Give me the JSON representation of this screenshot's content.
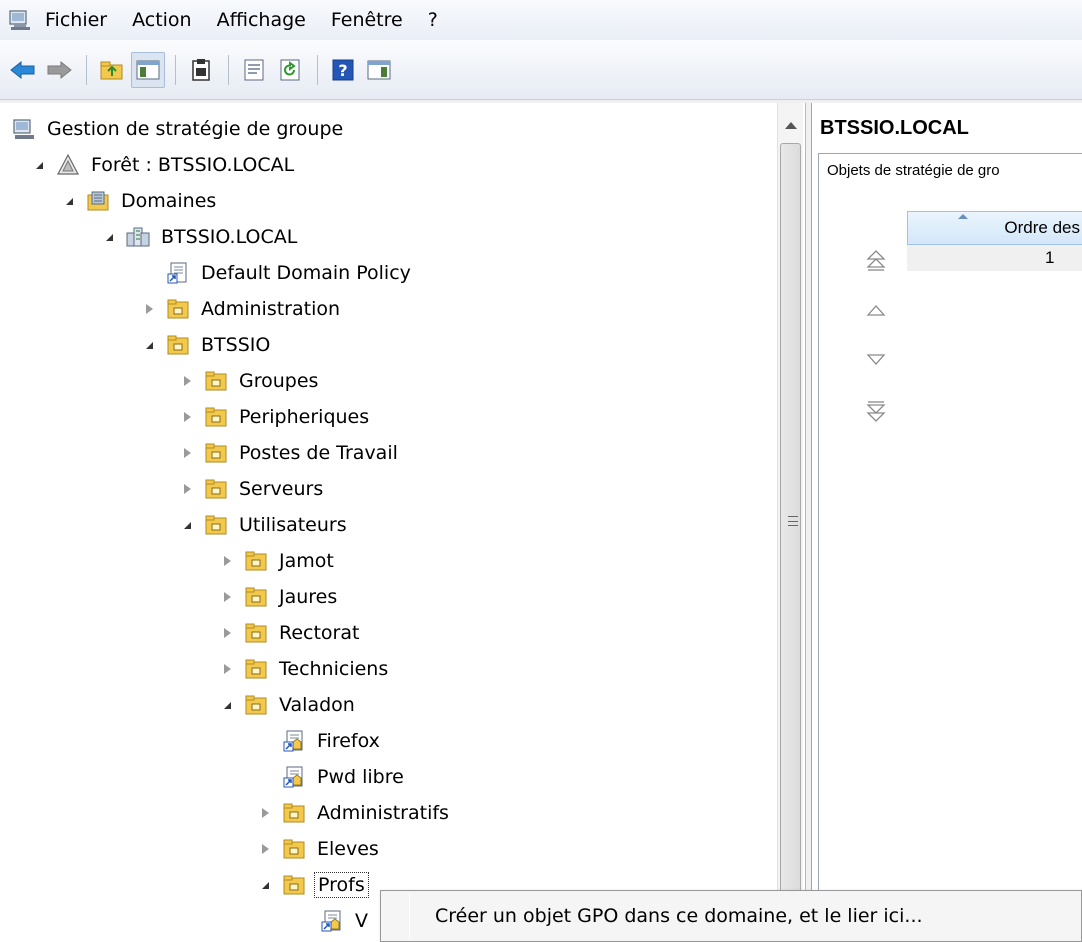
{
  "menubar": {
    "items": [
      "Fichier",
      "Action",
      "Affichage",
      "Fenêtre",
      "?"
    ]
  },
  "toolbar": {
    "buttons": [
      "back-arrow-icon",
      "forward-arrow-icon",
      "up-folder-icon",
      "show-hide-tree-icon",
      "clipboard-icon",
      "properties-icon",
      "refresh-icon",
      "help-icon",
      "console-icon"
    ]
  },
  "tree": {
    "root": "Gestion de stratégie de groupe",
    "forest": "Forêt : BTSSIO.LOCAL",
    "domains": "Domaines",
    "domain": "BTSSIO.LOCAL",
    "default_policy": "Default Domain Policy",
    "administration": "Administration",
    "btssio": "BTSSIO",
    "groupes": "Groupes",
    "peripheriques": "Peripheriques",
    "postes": "Postes de Travail",
    "serveurs": "Serveurs",
    "utilisateurs": "Utilisateurs",
    "jamot": "Jamot",
    "jaures": "Jaures",
    "rectorat": "Rectorat",
    "techniciens": "Techniciens",
    "valadon": "Valadon",
    "firefox": "Firefox",
    "pwd_libre": "Pwd libre",
    "administratifs": "Administratifs",
    "eleves": "Eleves",
    "profs": "Profs",
    "profs_child": "V"
  },
  "right_pane": {
    "title": "BTSSIO.LOCAL",
    "tab": "Objets de stratégie de gro",
    "column_header": "Ordre des",
    "row_value": "1"
  },
  "context_menu": {
    "item": "Créer un objet GPO dans ce domaine, et le lier ici..."
  }
}
